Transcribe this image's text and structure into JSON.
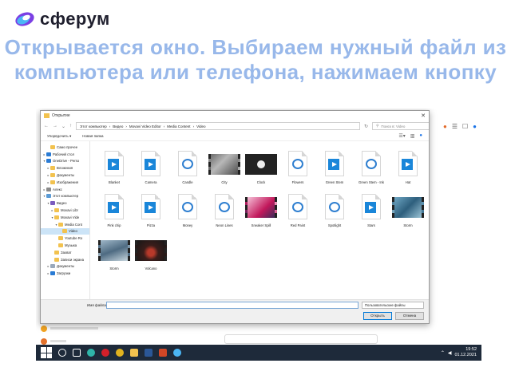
{
  "brand": {
    "logo_text": "сферум"
  },
  "slide": {
    "heading": "Открывается окно. Выбираем нужный файл из компьютера или телефона, нажимаем кнопку"
  },
  "dialog": {
    "title": "Открытие",
    "close_label": "✕",
    "path": [
      "Этот компьютер",
      "Видео",
      "Movavi Video Editor",
      "Media Content",
      "Video"
    ],
    "search_placeholder": "Поиск в: Video",
    "toolbar": {
      "organize": "Упорядочить ▾",
      "new_folder": "Новая папка"
    },
    "tree": [
      {
        "label": "Само прочее",
        "icon": "folder",
        "level": 1,
        "caret": ""
      },
      {
        "label": "Рабочий стол",
        "icon": "cloud",
        "level": 0,
        "caret": "▸"
      },
      {
        "label": "OneDrive - Perso",
        "icon": "cloud",
        "level": 0,
        "caret": "▾"
      },
      {
        "label": "Вложения",
        "icon": "folder",
        "level": 1,
        "caret": "▸"
      },
      {
        "label": "Документы",
        "icon": "folder",
        "level": 1,
        "caret": "▸"
      },
      {
        "label": "Изображения",
        "icon": "folder",
        "level": 1,
        "caret": "▸"
      },
      {
        "label": "Алекс",
        "icon": "user",
        "level": 0,
        "caret": "▸"
      },
      {
        "label": "Этот компьютер",
        "icon": "pc",
        "level": 0,
        "caret": "▾"
      },
      {
        "label": "Видео",
        "icon": "video",
        "level": 1,
        "caret": "▾"
      },
      {
        "label": "Movavi Libr",
        "icon": "folder",
        "level": 2,
        "caret": "▸"
      },
      {
        "label": "Movavi Vide",
        "icon": "folder",
        "level": 2,
        "caret": "▾"
      },
      {
        "label": "Media Cont",
        "icon": "folder",
        "level": 3,
        "caret": "▾"
      },
      {
        "label": "Video",
        "icon": "folder",
        "level": 4,
        "caret": "",
        "selected": true
      },
      {
        "label": "Youtube Ro",
        "icon": "folder",
        "level": 3,
        "caret": ""
      },
      {
        "label": "Музыка",
        "icon": "folder",
        "level": 3,
        "caret": ""
      },
      {
        "label": "Захват",
        "icon": "folder",
        "level": 2,
        "caret": ""
      },
      {
        "label": "Записи экрана",
        "icon": "folder",
        "level": 2,
        "caret": ""
      },
      {
        "label": "Документы",
        "icon": "doc",
        "level": 1,
        "caret": "▸"
      },
      {
        "label": "Загрузки",
        "icon": "down",
        "level": 1,
        "caret": "▸"
      }
    ],
    "files": [
      {
        "name": "Blanket",
        "kind": "play"
      },
      {
        "name": "Camera",
        "kind": "play"
      },
      {
        "name": "Candle",
        "kind": "qt"
      },
      {
        "name": "City",
        "kind": "video",
        "tone": "city"
      },
      {
        "name": "Clock",
        "kind": "video",
        "tone": "clock"
      },
      {
        "name": "Flowers",
        "kind": "qt"
      },
      {
        "name": "Green Stem",
        "kind": "play"
      },
      {
        "name": "Green Stem - Ink",
        "kind": "qt"
      },
      {
        "name": "Hat",
        "kind": "play"
      },
      {
        "name": "Pink chip",
        "kind": "play"
      },
      {
        "name": "Pizza",
        "kind": "play"
      },
      {
        "name": "Money",
        "kind": "qt"
      },
      {
        "name": "Neon Lines",
        "kind": "qt"
      },
      {
        "name": "Sneaker Spill",
        "kind": "video",
        "tone": "pink"
      },
      {
        "name": "Red Paint",
        "kind": "qt"
      },
      {
        "name": "Spotlight",
        "kind": "qt"
      },
      {
        "name": "Stars",
        "kind": "play"
      },
      {
        "name": "Storm",
        "kind": "video",
        "tone": "storm"
      },
      {
        "name": "Storm",
        "kind": "video",
        "tone": "blue"
      },
      {
        "name": "Volcano",
        "kind": "video",
        "tone": "volcano"
      }
    ],
    "footer": {
      "filename_label": "Имя файла:",
      "filename_value": "",
      "filetype": "Пользовательские файлы",
      "open_label": "Открыть",
      "cancel_label": "Отмена"
    }
  },
  "taskbar": {
    "time": "19:52",
    "date": "01.12.2021"
  },
  "colors": {
    "heading": "#98b8ea",
    "accent": "#0078d7",
    "taskbar": "#1e2a3a"
  }
}
